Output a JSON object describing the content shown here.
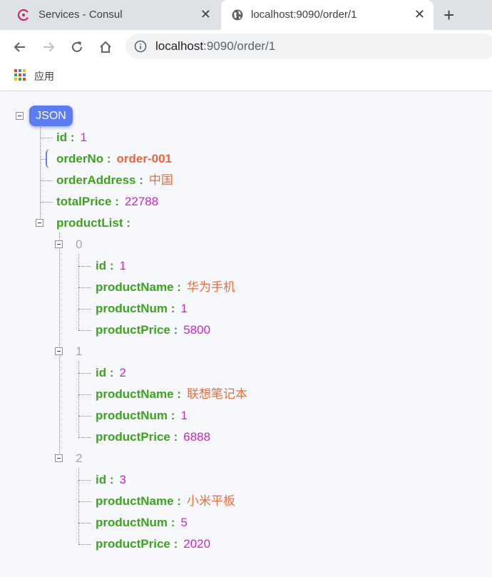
{
  "browser": {
    "tabs": [
      {
        "title": "Services - Consul",
        "icon": "consul-icon",
        "active": false
      },
      {
        "title": "localhost:9090/order/1",
        "icon": "globe-icon",
        "active": true
      }
    ],
    "address": {
      "host": "localhost",
      "path": ":9090/order/1"
    },
    "bookmarks": {
      "apps_label": "应用"
    }
  },
  "json_view": {
    "root_label": "JSON",
    "fields": {
      "id": {
        "key": "id :",
        "value": "1"
      },
      "orderNo": {
        "key": "orderNo :",
        "value": "order-001"
      },
      "orderAddress": {
        "key": "orderAddress :",
        "value": "中国"
      },
      "totalPrice": {
        "key": "totalPrice :",
        "value": "22788"
      },
      "productList": {
        "key": "productList :"
      }
    },
    "products": [
      {
        "index": "0",
        "id_key": "id :",
        "id": "1",
        "name_key": "productName :",
        "name": "华为手机",
        "num_key": "productNum :",
        "num": "1",
        "price_key": "productPrice :",
        "price": "5800"
      },
      {
        "index": "1",
        "id_key": "id :",
        "id": "2",
        "name_key": "productName :",
        "name": "联想笔记本",
        "num_key": "productNum :",
        "num": "1",
        "price_key": "productPrice :",
        "price": "6888"
      },
      {
        "index": "2",
        "id_key": "id :",
        "id": "3",
        "name_key": "productName :",
        "name": "小米平板",
        "num_key": "productNum :",
        "num": "5",
        "price_key": "productPrice :",
        "price": "2020"
      }
    ]
  },
  "colors": {
    "key": "#3aa51c",
    "number": "#d11fd1",
    "string": "#f06b3a",
    "badge": "#5b7cf7"
  }
}
